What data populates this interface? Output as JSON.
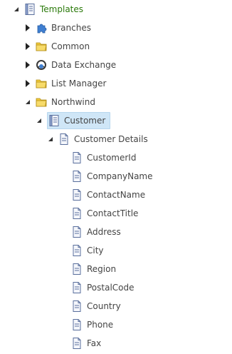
{
  "tree": {
    "root": {
      "label": "Templates",
      "icon": "template-icon",
      "expanded": true
    },
    "items": [
      {
        "label": "Branches",
        "icon": "branch-puzzle-icon",
        "expanded": false
      },
      {
        "label": "Common",
        "icon": "folder-icon",
        "expanded": false
      },
      {
        "label": "Data Exchange",
        "icon": "data-exchange-icon",
        "expanded": false
      },
      {
        "label": "List Manager",
        "icon": "folder-icon",
        "expanded": false
      },
      {
        "label": "Northwind",
        "icon": "folder-icon",
        "expanded": true
      },
      {
        "label": "Customer",
        "icon": "template-icon",
        "expanded": true,
        "selected": true
      },
      {
        "label": "Customer Details",
        "icon": "document-icon",
        "expanded": true
      }
    ],
    "fields": [
      "CustomerId",
      "CompanyName",
      "ContactName",
      "ContactTitle",
      "Address",
      "City",
      "Region",
      "PostalCode",
      "Country",
      "Phone",
      "Fax"
    ]
  },
  "colors": {
    "root_label": "#2b7a0b",
    "text": "#444444",
    "selection_bg": "#cfe6f7",
    "folder": "#f2cc3d"
  }
}
